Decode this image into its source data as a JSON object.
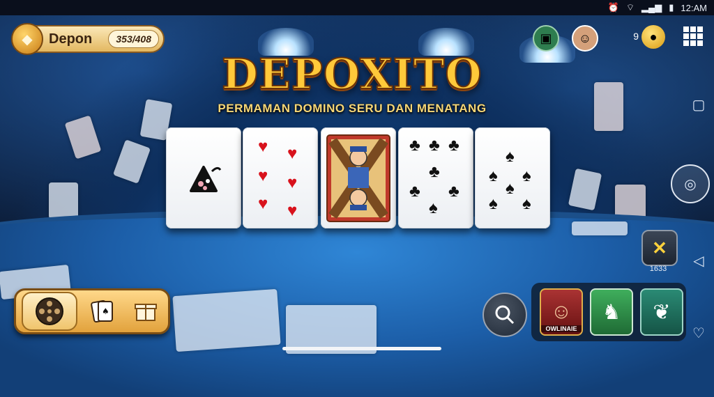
{
  "status_bar": {
    "time": "12:AM"
  },
  "deposit": {
    "label": "Depon",
    "value": "353/408"
  },
  "title": "DEPOXITO",
  "subtitle": "PERMAMAN DOMINO SERU DAN MENATANG",
  "top_right": {
    "count": "9"
  },
  "cards": [
    {
      "name": "card-special",
      "suit": "special"
    },
    {
      "name": "card-hearts",
      "suit": "hearts",
      "pips": 6
    },
    {
      "name": "card-face",
      "suit": "face"
    },
    {
      "name": "card-clubs",
      "suit": "clubs",
      "pips": 6
    },
    {
      "name": "card-spades",
      "suit": "spades",
      "pips": 6
    }
  ],
  "badge": {
    "value": "1633"
  },
  "game_tray": [
    {
      "label": "OWLINAIE"
    },
    {
      "label": ""
    },
    {
      "label": ""
    }
  ],
  "colors": {
    "gold": "#ffc93a",
    "felt": "#1c5ea8",
    "panel": "#e2a23c"
  }
}
